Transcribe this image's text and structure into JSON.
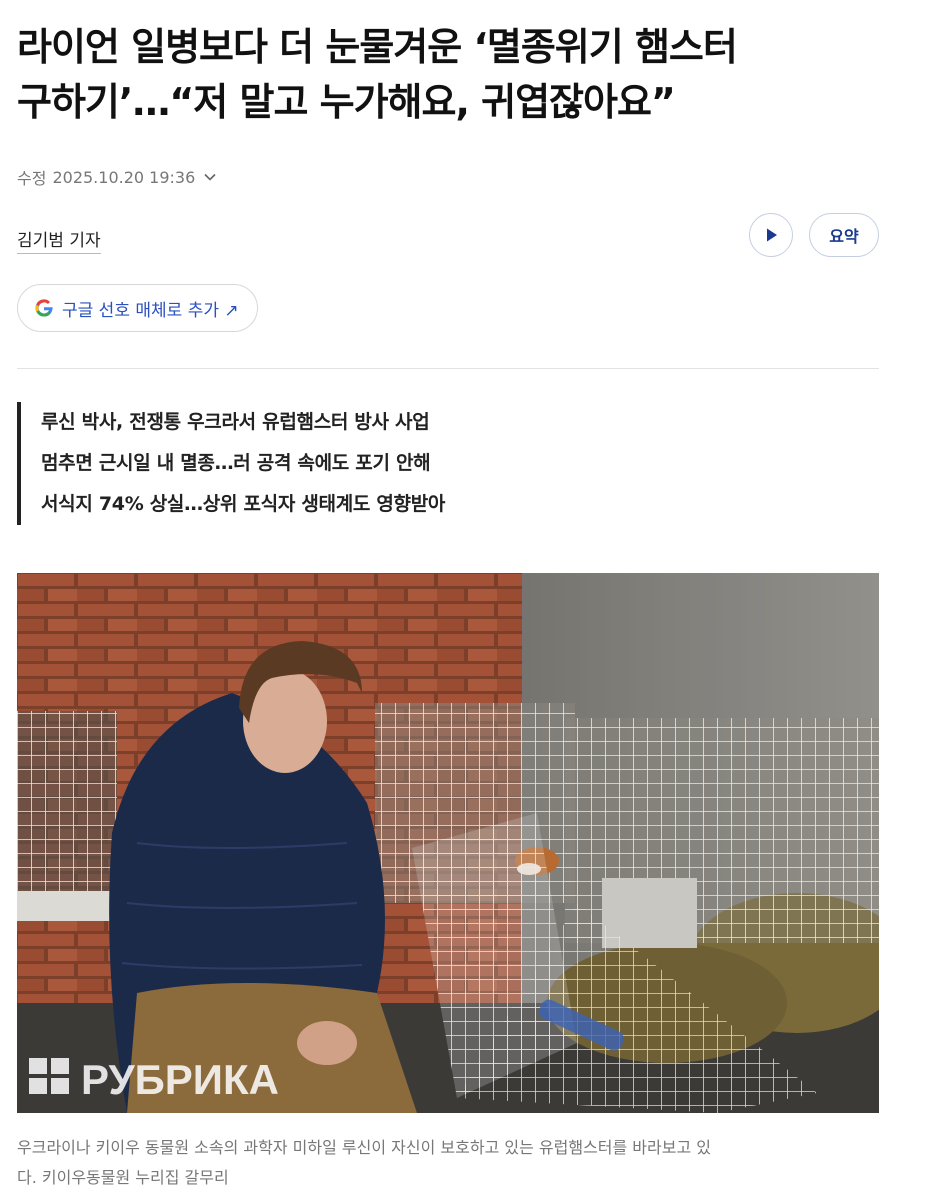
{
  "article": {
    "title_line1": "라이언 일병보다 더 눈물겨운 ‘멸종위기 햄스터",
    "title_line2": "구하기’…“저 말고 누가해요, 귀엽잖아요”",
    "modified_label": "수정",
    "modified_datetime": "2025.10.20 19:36",
    "author": "김기범 기자",
    "summary_button_label": "요약",
    "google_button_label": "구글 선호 매체로 추가 ↗",
    "summary_lines": [
      "루신 박사, 전쟁통 우크라서 유럽햄스터 방사 사업",
      "멈추면 근시일 내 멸종…러 공격 속에도 포기 안해",
      "서식지 74% 상실…상위 포식자 생태계도 영향받아"
    ],
    "photo_watermark": "РУБРИКА",
    "caption_line1": "우크라이나 키이우 동물원 소속의 과학자 미하일 루신이 자신이 보호하고 있는 유럽햄스터를 바라보고 있",
    "caption_line2": "다. 키이우동물원 누리집 갈무리"
  },
  "colors": {
    "accent_blue": "#2a4fbf",
    "button_border": "#c5cde0",
    "summary_bar": "#222222"
  },
  "icons": [
    "chevron-down-icon",
    "play-icon",
    "google-g-icon"
  ]
}
